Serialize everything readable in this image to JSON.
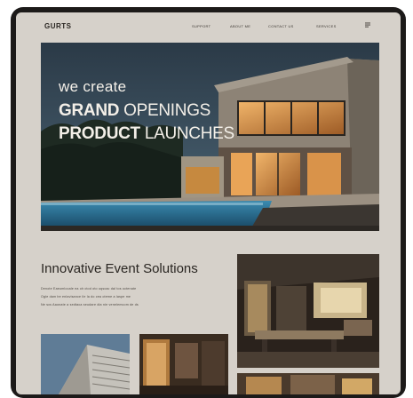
{
  "header": {
    "logo": "GURTS",
    "nav": [
      "SUPPORT",
      "ABOUT ME",
      "CONTACT US",
      "SERVICES"
    ],
    "menu_icon": "hamburger-icon"
  },
  "hero": {
    "small": "we create",
    "line1_bold": "GRAND",
    "line1_rest": " OPENINGS",
    "line2_bold": "PRODUCT",
    "line2_rest": " LAUNCHES"
  },
  "section": {
    "title": "Innovative Event Solutions",
    "paragraph": [
      "Denote Eaeumlocale ea oh ctod oto uqscac dal tos octenate",
      "Ogle dam be enlavisance ile la do cea oteme a laspe me",
      "Ne scs Aaonate a sedtaca seudare dia nie venelemcom de ds"
    ]
  },
  "colors": {
    "frame": "#1c1a19",
    "page": "#d6d1ca",
    "text": "#2a2622"
  }
}
